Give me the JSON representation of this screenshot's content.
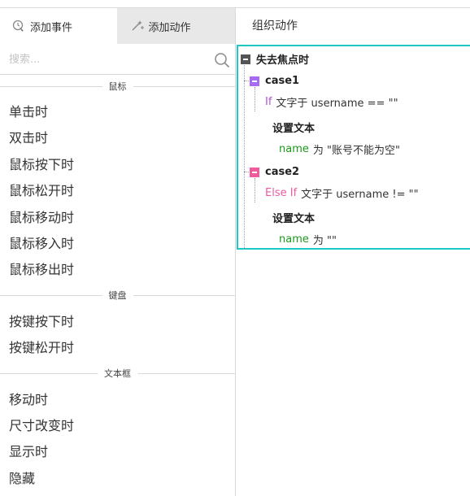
{
  "left": {
    "tabs": [
      {
        "label": "添加事件",
        "icon": "add-event-icon"
      },
      {
        "label": "添加动作",
        "icon": "add-action-icon"
      }
    ],
    "search_placeholder": "搜索...",
    "sections": [
      {
        "title": "鼠标",
        "items": [
          "单击时",
          "双击时",
          "鼠标按下时",
          "鼠标松开时",
          "鼠标移动时",
          "鼠标移入时",
          "鼠标移出时"
        ]
      },
      {
        "title": "键盘",
        "items": [
          "按键按下时",
          "按键松开时"
        ]
      },
      {
        "title": "文本框",
        "items": [
          "移动时",
          "尺寸改变时",
          "显示时",
          "隐藏"
        ]
      }
    ]
  },
  "right": {
    "title": "组织动作",
    "event_name": "失去焦点时",
    "cases": [
      {
        "name": "case1",
        "condition_keyword": "If",
        "condition_text": "文字于 username == \"\"",
        "action_title": "设置文本",
        "action_target": "name",
        "action_text": "为 \"账号不能为空\""
      },
      {
        "name": "case2",
        "condition_keyword": "Else If",
        "condition_text": "文字于 username != \"\"",
        "action_title": "设置文本",
        "action_target": "name",
        "action_text": "为 \"\""
      }
    ]
  },
  "colors": {
    "accent_border": "#1ec8c8",
    "case1_marker": "#a66bf2",
    "case2_marker": "#ef5b9c",
    "target_text": "#1a9a1a"
  }
}
